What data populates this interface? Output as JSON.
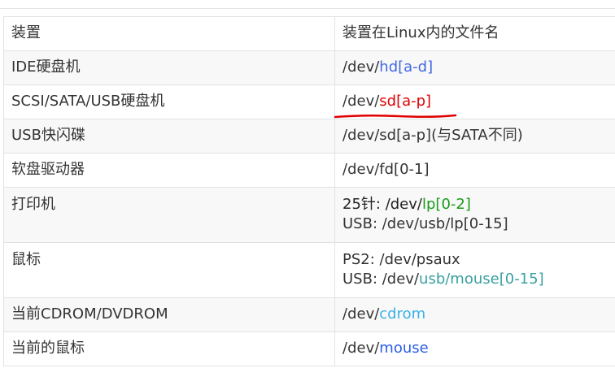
{
  "header": {
    "col1": "装置",
    "col2": "装置在Linux内的文件名"
  },
  "rows": [
    {
      "device": "IDE硬盘机",
      "path_prefix": "/dev/",
      "path_highlight": "hd[a-d]"
    },
    {
      "device": "SCSI/SATA/USB硬盘机",
      "path_prefix": "/dev/",
      "path_highlight": "sd[a-p]"
    },
    {
      "device": "USB快闪碟",
      "path": "/dev/sd[a-p](与SATA不同)"
    },
    {
      "device": "软盘驱动器",
      "path": "/dev/fd[0-1]"
    },
    {
      "device": "打印机",
      "line1_prefix": "25针: /dev/",
      "line1_hl_a": "lp",
      "line1_hl_b": "[0-2]",
      "line2": "USB: /dev/usb/lp[0-15]"
    },
    {
      "device": "鼠标",
      "line1": "PS2: /dev/psaux",
      "line2_prefix": "USB: /dev/",
      "line2_hl": "usb/mouse[0-15]"
    },
    {
      "device": "当前CDROM/DVDROM",
      "path_prefix": "/dev/",
      "path_highlight": "cdrom"
    },
    {
      "device": "当前的鼠标",
      "path_prefix": "/dev/",
      "path_highlight": "mouse"
    }
  ],
  "colors": {
    "blue": "#4169e1",
    "red": "#e00000",
    "green": "#1a9a1a",
    "teal": "#3aa0a0",
    "cyan": "#3bb0e8",
    "annotation_underline": "#e00000"
  }
}
